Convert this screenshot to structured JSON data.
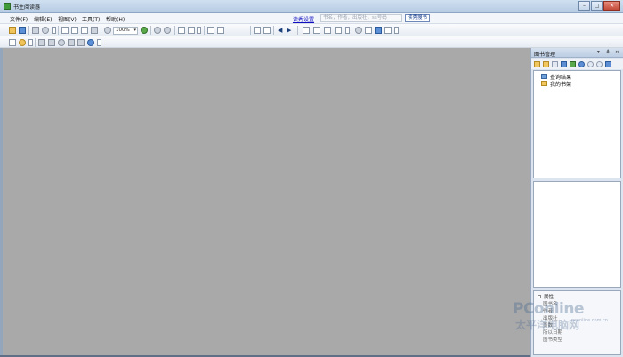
{
  "window": {
    "title": "书生阅读器",
    "icon": "app-icon",
    "controls": [
      "minimize",
      "maximize",
      "close"
    ]
  },
  "menu": {
    "items": [
      "文件(F)",
      "编辑(E)",
      "视图(V)",
      "工具(T)",
      "帮助(H)"
    ],
    "center_link": "读秀设置",
    "search_placeholder": "书名，作者，出版社，ss号码",
    "search_button": "读秀搜书"
  },
  "toolbar": {
    "zoom_value": "100%"
  },
  "side_panel": {
    "title": "图书管理",
    "header_controls": [
      "▾",
      "♁",
      "×"
    ],
    "tree": [
      {
        "label": "查询结果",
        "icon": "search-result-icon"
      },
      {
        "label": "我的书架",
        "icon": "folder-icon"
      }
    ],
    "bottom": {
      "group": "属性",
      "rows": [
        "图书名",
        "作者",
        "出版社",
        "页数",
        "所以日期",
        "图书类型"
      ]
    }
  },
  "watermark": {
    "brand": "PConline",
    "sub": "太平洋电脑网",
    "url": "pconline.com.cn"
  },
  "colors": {
    "workspace": "#a9a9a9",
    "accent_link": "#1010c0",
    "titlebar": "#cfe0f1"
  }
}
